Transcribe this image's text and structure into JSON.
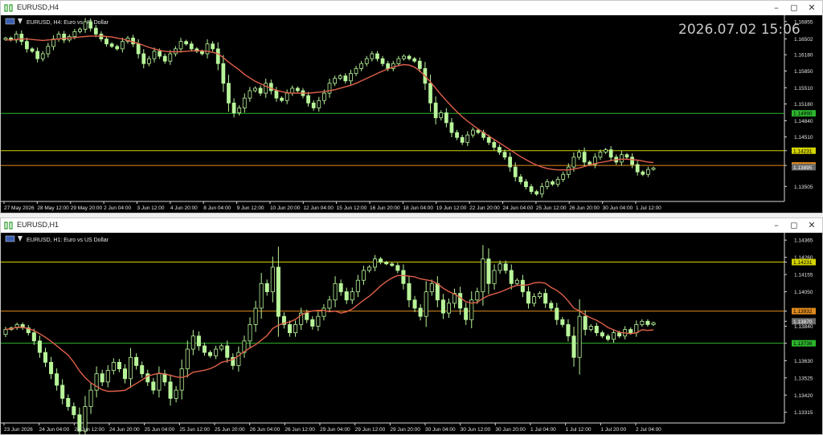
{
  "windows": [
    {
      "id": "h4",
      "title": "EURUSD,H4",
      "label": "EURUSD, H4:  Euro vs US Dollar",
      "clock": "2026.07.02 15:06",
      "y_ticks": [
        "1.16855",
        "1.16502",
        "1.16180",
        "1.15850",
        "1.15510",
        "1.15180",
        "1.14840",
        "1.14510",
        "1.14231",
        "1.13932",
        "1.13505"
      ],
      "x_ticks": [
        "27 May 2026",
        "28 May 12:00",
        "29 May 20:00",
        "2 Jun 04:00",
        "3 Jun 12:00",
        "4 Jun 20:00",
        "8 Jun 04:00",
        "9 Jun 12:00",
        "10 Jun 20:00",
        "12 Jun 04:00",
        "15 Jun 12:00",
        "16 Jun 20:00",
        "18 Jun 04:00",
        "19 Jun 12:00",
        "22 Jun 20:00",
        "24 Jun 04:00",
        "25 Jun 12:00",
        "26 Jun 20:00",
        "30 Jun 04:00",
        "1 Jul 12:00"
      ],
      "levels": [
        {
          "price": "1.14990",
          "color": "#2db52d",
          "label": "1.14990"
        },
        {
          "price": "1.14231",
          "color": "#d4d400",
          "label": "1.14231"
        },
        {
          "price": "1.13932",
          "color": "#e08a1e",
          "label": "1.13932"
        }
      ],
      "current_price": "1.13895",
      "ylim": [
        1.132,
        1.1695
      ]
    },
    {
      "id": "h1",
      "title": "EURUSD,H1",
      "label": "EURUSD, H1:  Euro vs US Dollar",
      "y_ticks": [
        "1.14365",
        "1.14260",
        "1.14231",
        "1.14155",
        "1.14050",
        "1.13932",
        "1.13870",
        "1.13840",
        "1.13736",
        "1.13630",
        "1.13525",
        "1.13420",
        "1.13315"
      ],
      "x_ticks": [
        "23 Jun 2026",
        "24 Jun 04:00",
        "24 Jun 12:00",
        "24 Jun 20:00",
        "25 Jun 04:00",
        "25 Jun 12:00",
        "25 Jun 20:00",
        "26 Jun 04:00",
        "26 Jun 12:00",
        "29 Jun 04:00",
        "29 Jun 12:00",
        "29 Jun 20:00",
        "30 Jun 04:00",
        "30 Jun 12:00",
        "30 Jun 20:00",
        "1 Jul 04:00",
        "1 Jul 12:00",
        "1 Jul 20:00",
        "2 Jul 04:00"
      ],
      "levels": [
        {
          "price": "1.14231",
          "color": "#d4d400",
          "label": "1.14231"
        },
        {
          "price": "1.13932",
          "color": "#e08a1e",
          "label": "1.13932"
        },
        {
          "price": "1.13736",
          "color": "#2db52d",
          "label": "1.13736"
        }
      ],
      "current_price": "1.13870",
      "ylim": [
        1.1325,
        1.144
      ]
    }
  ],
  "chart_data": [
    {
      "type": "candlestick",
      "title": "EURUSD, H4:  Euro vs US Dollar",
      "ma_color": "#e0604a",
      "candle_color": "#b8f59a",
      "closes": [
        1.1652,
        1.1648,
        1.166,
        1.1645,
        1.163,
        1.1625,
        1.161,
        1.162,
        1.1635,
        1.165,
        1.166,
        1.1648,
        1.1655,
        1.1665,
        1.167,
        1.1685,
        1.1672,
        1.166,
        1.165,
        1.164,
        1.1635,
        1.163,
        1.1645,
        1.1652,
        1.164,
        1.162,
        1.16,
        1.161,
        1.1625,
        1.1615,
        1.1605,
        1.162,
        1.163,
        1.1645,
        1.164,
        1.163,
        1.1625,
        1.162,
        1.164,
        1.163,
        1.16,
        1.156,
        1.152,
        1.15,
        1.151,
        1.153,
        1.1545,
        1.155,
        1.154,
        1.156,
        1.1545,
        1.153,
        1.1525,
        1.154,
        1.155,
        1.1545,
        1.1535,
        1.152,
        1.151,
        1.1525,
        1.154,
        1.156,
        1.157,
        1.1575,
        1.1565,
        1.158,
        1.159,
        1.16,
        1.161,
        1.162,
        1.161,
        1.16,
        1.159,
        1.16,
        1.161,
        1.1615,
        1.161,
        1.1605,
        1.159,
        1.156,
        1.152,
        1.149,
        1.15,
        1.148,
        1.146,
        1.145,
        1.144,
        1.1455,
        1.1465,
        1.146,
        1.145,
        1.144,
        1.143,
        1.142,
        1.141,
        1.139,
        1.137,
        1.136,
        1.135,
        1.134,
        1.1335,
        1.135,
        1.136,
        1.1355,
        1.1365,
        1.1375,
        1.139,
        1.141,
        1.142,
        1.14,
        1.1395,
        1.141,
        1.142,
        1.1425,
        1.141,
        1.14,
        1.1415,
        1.141,
        1.1395,
        1.138,
        1.1375,
        1.1385,
        1.1388
      ],
      "ma": [
        1.1648,
        1.1648,
        1.1649,
        1.165,
        1.165,
        1.1649,
        1.1648,
        1.1647,
        1.1648,
        1.1649,
        1.165,
        1.1651,
        1.1652,
        1.1653,
        1.1654,
        1.1655,
        1.1656,
        1.1656,
        1.1656,
        1.1655,
        1.1654,
        1.1652,
        1.165,
        1.1647,
        1.1644,
        1.1641,
        1.1637,
        1.1633,
        1.163,
        1.1627,
        1.1625,
        1.1624,
        1.1624,
        1.1624,
        1.1625,
        1.1626,
        1.1626,
        1.1626,
        1.1625,
        1.1623,
        1.162,
        1.1612,
        1.1603,
        1.1595,
        1.1587,
        1.1578,
        1.1571,
        1.1564,
        1.1559,
        1.1554,
        1.155,
        1.1546,
        1.1543,
        1.1541,
        1.154,
        1.154,
        1.154,
        1.154,
        1.1541,
        1.1542,
        1.1543,
        1.1545,
        1.1547,
        1.155,
        1.1553,
        1.1556,
        1.156,
        1.1565,
        1.157,
        1.1575,
        1.158,
        1.1585,
        1.1589,
        1.1593,
        1.1596,
        1.1598,
        1.1597,
        1.1593,
        1.1585,
        1.1575,
        1.1563,
        1.155,
        1.1537,
        1.1525,
        1.1513,
        1.1502,
        1.1492,
        1.1483,
        1.1475,
        1.1467,
        1.146,
        1.1453,
        1.1446,
        1.1439,
        1.1432,
        1.1425,
        1.1418,
        1.1411,
        1.1405,
        1.1399,
        1.1394,
        1.139,
        1.1387,
        1.1385,
        1.1384,
        1.1384,
        1.1384,
        1.1386,
        1.1388,
        1.1391,
        1.1394,
        1.1397,
        1.1399,
        1.1401,
        1.1403,
        1.1405,
        1.1406,
        1.1406,
        1.1405,
        1.1404,
        1.1402,
        1.14,
        1.1399
      ]
    },
    {
      "type": "candlestick",
      "title": "EURUSD, H1:  Euro vs US Dollar",
      "ma_color": "#e0604a",
      "candle_color": "#b8f59a",
      "closes": [
        1.1382,
        1.1383,
        1.1385,
        1.1383,
        1.138,
        1.1375,
        1.1368,
        1.1362,
        1.1355,
        1.1348,
        1.134,
        1.1335,
        1.133,
        1.132,
        1.1335,
        1.1345,
        1.1355,
        1.135,
        1.1357,
        1.1362,
        1.1358,
        1.1352,
        1.1365,
        1.136,
        1.1355,
        1.135,
        1.1345,
        1.1355,
        1.135,
        1.134,
        1.1345,
        1.1358,
        1.137,
        1.1378,
        1.1372,
        1.1368,
        1.1366,
        1.137,
        1.1372,
        1.1365,
        1.136,
        1.1368,
        1.1375,
        1.1385,
        1.1395,
        1.141,
        1.1405,
        1.142,
        1.139,
        1.1385,
        1.138,
        1.1385,
        1.1392,
        1.1388,
        1.1384,
        1.139,
        1.1395,
        1.14,
        1.141,
        1.1405,
        1.14,
        1.1405,
        1.1412,
        1.1418,
        1.142,
        1.1425,
        1.1423,
        1.1422,
        1.1421,
        1.1418,
        1.141,
        1.14,
        1.1395,
        1.139,
        1.1405,
        1.141,
        1.14,
        1.1392,
        1.1398,
        1.1404,
        1.1395,
        1.1388,
        1.14,
        1.1405,
        1.1425,
        1.141,
        1.1418,
        1.1422,
        1.1418,
        1.141,
        1.1412,
        1.1405,
        1.1398,
        1.1402,
        1.1404,
        1.1398,
        1.1395,
        1.1388,
        1.1385,
        1.1378,
        1.1365,
        1.139,
        1.1382,
        1.1384,
        1.138,
        1.1378,
        1.1376,
        1.138,
        1.1378,
        1.1382,
        1.138,
        1.1385,
        1.1387,
        1.1385,
        1.1386
      ]
    }
  ]
}
